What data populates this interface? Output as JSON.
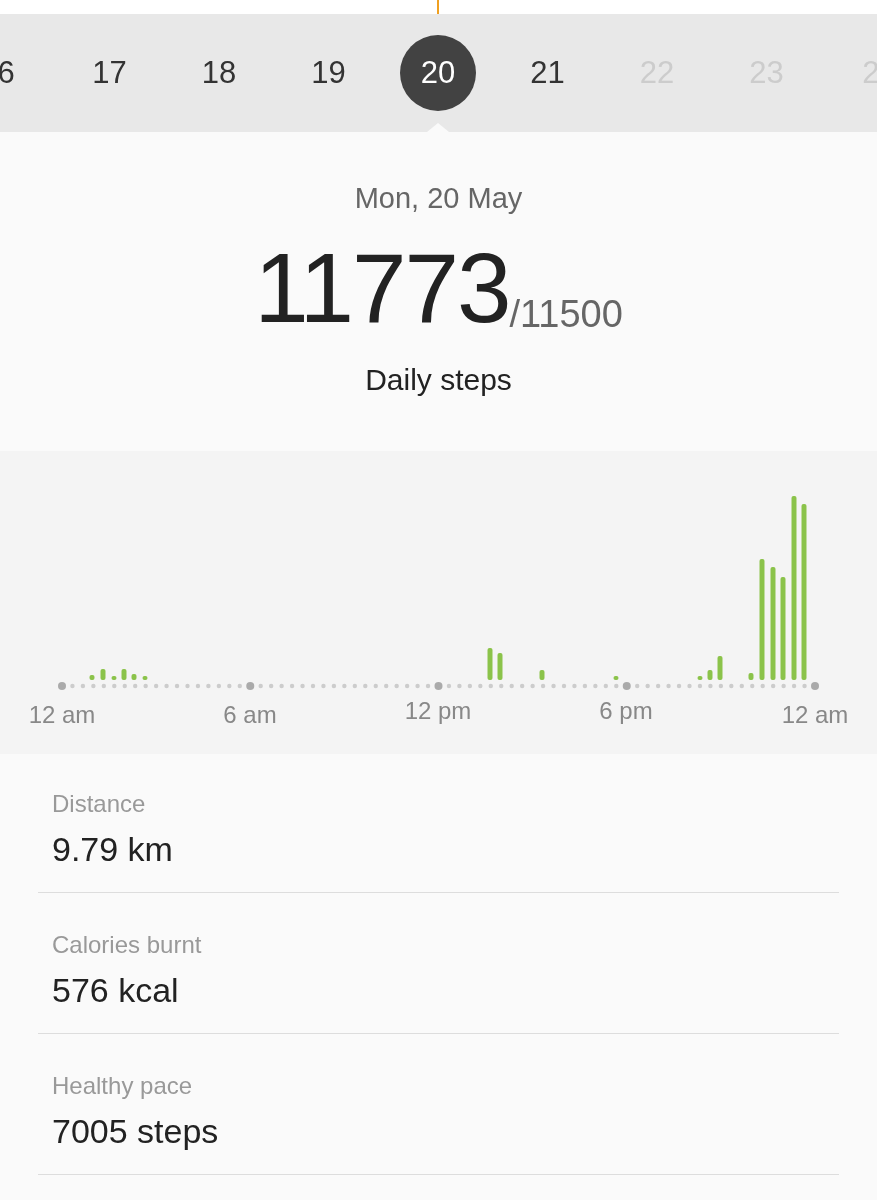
{
  "days": [
    {
      "label": "6",
      "selected": false,
      "disabled": false
    },
    {
      "label": "17",
      "selected": false,
      "disabled": false
    },
    {
      "label": "18",
      "selected": false,
      "disabled": false
    },
    {
      "label": "19",
      "selected": false,
      "disabled": false
    },
    {
      "label": "20",
      "selected": true,
      "disabled": false
    },
    {
      "label": "21",
      "selected": false,
      "disabled": false
    },
    {
      "label": "22",
      "selected": false,
      "disabled": true
    },
    {
      "label": "23",
      "selected": false,
      "disabled": true
    },
    {
      "label": "2",
      "selected": false,
      "disabled": true
    }
  ],
  "date": "Mon, 20 May",
  "steps": {
    "count": "11773",
    "goal": "/11500",
    "label": "Daily steps"
  },
  "chart": {
    "axis_labels": [
      "12 am",
      "6 am",
      "12 pm",
      "6 pm",
      "12 am"
    ]
  },
  "stats": [
    {
      "label": "Distance",
      "value": "9.79 km"
    },
    {
      "label": "Calories burnt",
      "value": "576 kcal"
    },
    {
      "label": "Healthy pace",
      "value": "7005 steps"
    }
  ]
}
